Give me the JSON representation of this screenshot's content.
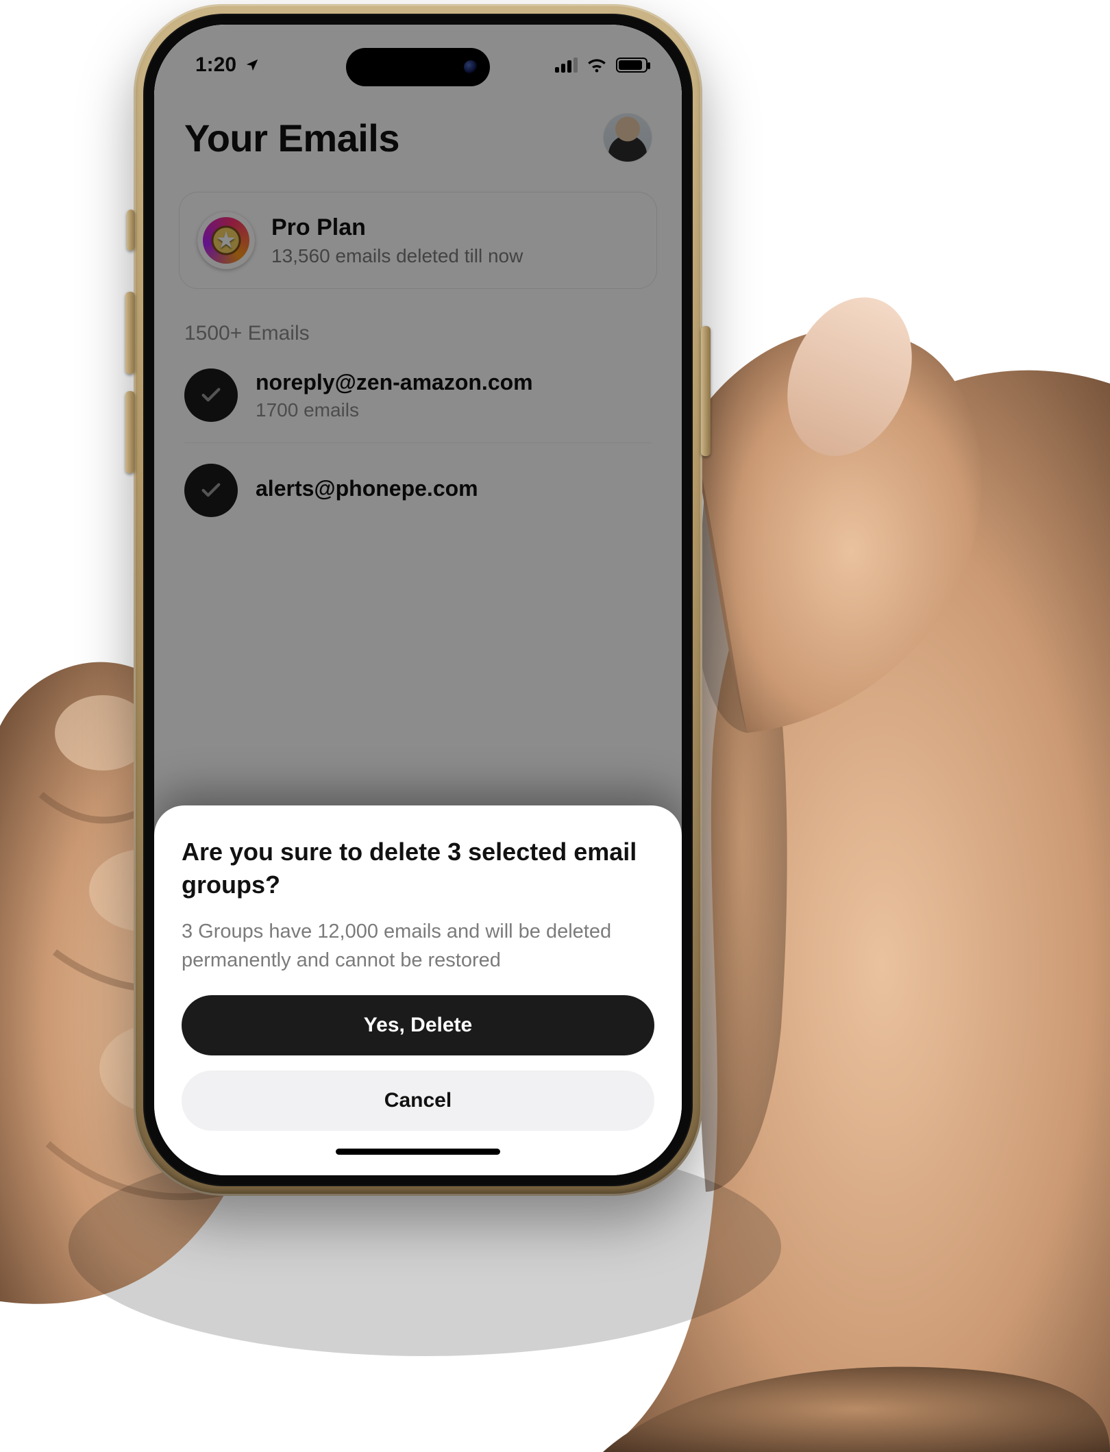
{
  "statusbar": {
    "time": "1:20"
  },
  "header": {
    "title": "Your Emails"
  },
  "plan": {
    "title": "Pro Plan",
    "subtitle": "13,560 emails deleted till now"
  },
  "section_label": "1500+ Emails",
  "senders": [
    {
      "email": "noreply@zen-amazon.com",
      "count_label": "1700 emails"
    },
    {
      "email": "alerts@phonepe.com",
      "count_label": ""
    }
  ],
  "dialog": {
    "title": "Are you sure to delete 3 selected email groups?",
    "body": "3 Groups have 12,000 emails and will be deleted permanently and cannot be restored",
    "confirm_label": "Yes, Delete",
    "cancel_label": "Cancel"
  }
}
